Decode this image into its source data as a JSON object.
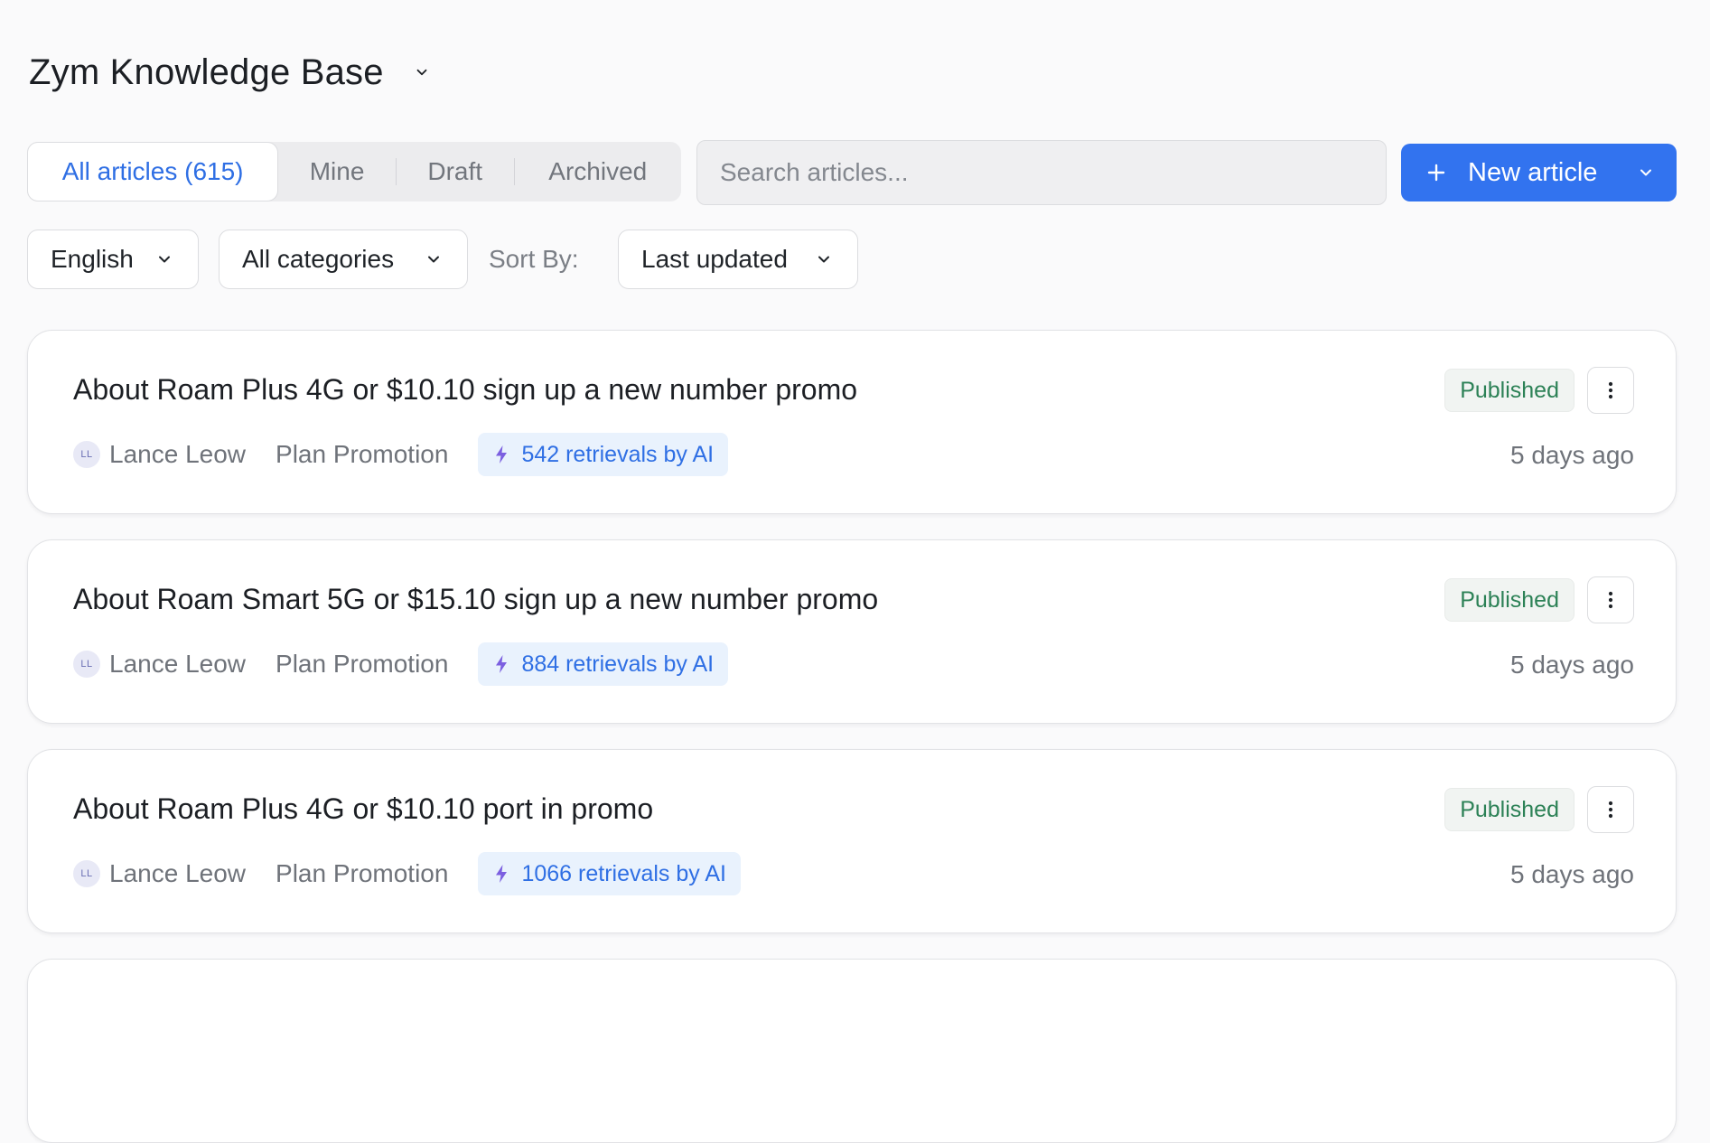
{
  "header": {
    "title": "Zym Knowledge Base"
  },
  "tabs": [
    {
      "label": "All articles (615)",
      "active": true
    },
    {
      "label": "Mine",
      "active": false
    },
    {
      "label": "Draft",
      "active": false
    },
    {
      "label": "Archived",
      "active": false
    }
  ],
  "search": {
    "placeholder": "Search articles...",
    "value": ""
  },
  "new_article": {
    "label": "New article",
    "color": "#3273ef"
  },
  "filters": {
    "language": "English",
    "category": "All categories",
    "sort_label": "Sort By:",
    "sort_value": "Last updated"
  },
  "articles": [
    {
      "title": "About Roam Plus 4G or $10.10 sign up a new number promo",
      "author_initials": "LL",
      "author": "Lance Leow",
      "category": "Plan Promotion",
      "retrievals": "542 retrievals by AI",
      "status": "Published",
      "updated": "5 days ago"
    },
    {
      "title": "About Roam Smart 5G or $15.10 sign up a new number promo",
      "author_initials": "LL",
      "author": "Lance Leow",
      "category": "Plan Promotion",
      "retrievals": "884 retrievals by AI",
      "status": "Published",
      "updated": "5 days ago"
    },
    {
      "title": "About Roam Plus 4G or $10.10 port in promo",
      "author_initials": "LL",
      "author": "Lance Leow",
      "category": "Plan Promotion",
      "retrievals": "1066 retrievals by AI",
      "status": "Published",
      "updated": "5 days ago"
    }
  ],
  "colors": {
    "accent": "#2f6fe4",
    "published": "#2c8156",
    "ai_badge_bg": "#e9f2fd",
    "bolt": "#7b5fe0"
  }
}
